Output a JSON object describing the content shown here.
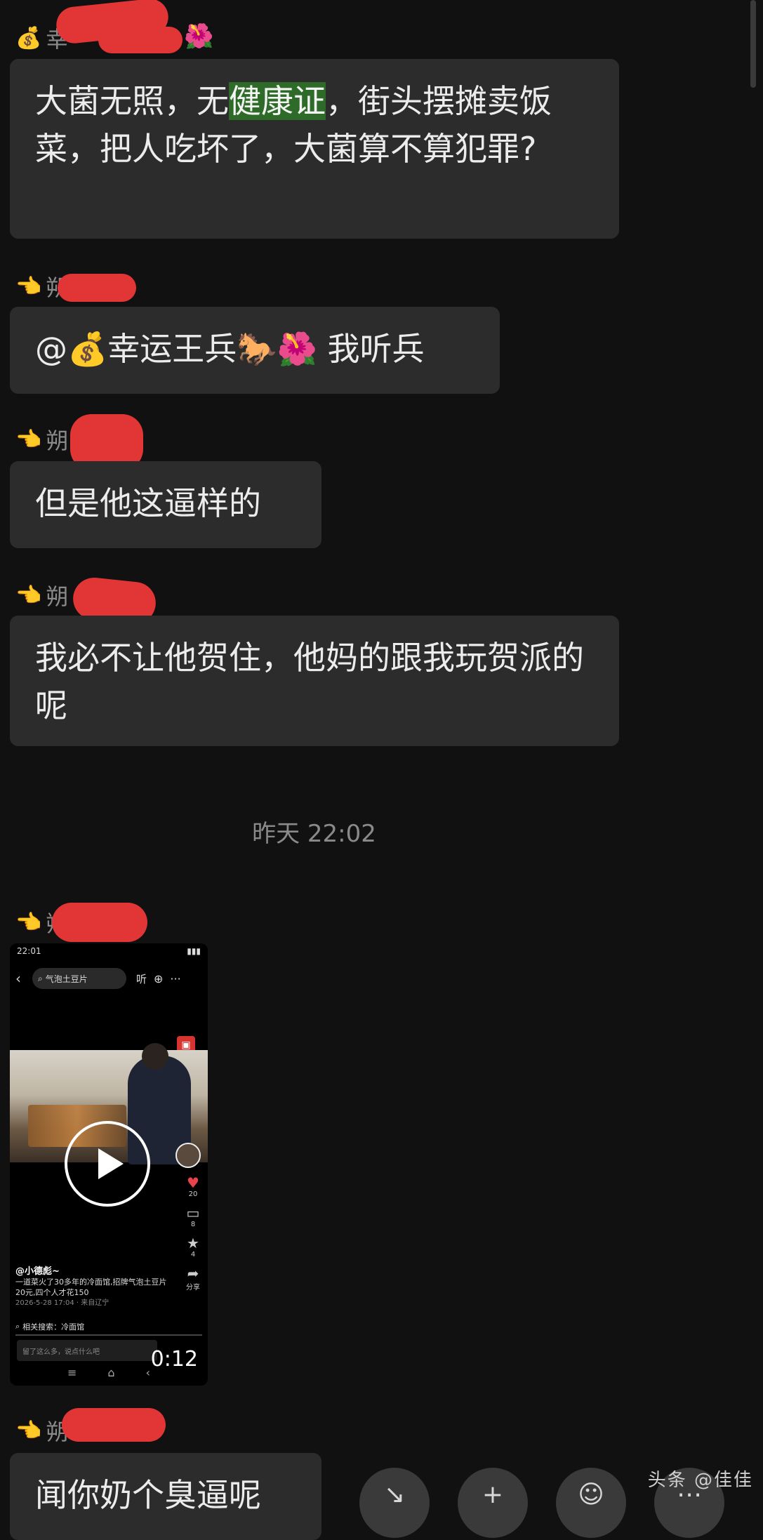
{
  "messages": [
    {
      "sender_prefix": "幸",
      "sender_icon": "money-bag-icon",
      "text_before": "大菌无照，无",
      "highlight": "健康证",
      "text_after": "，街头摆摊卖饭菜，把人吃坏了，大菌算不算犯罪?"
    },
    {
      "sender_prefix": "朔",
      "sender_icon": "pointing-hand-icon",
      "text": "@💰幸运王兵🐎🌺  我听兵"
    },
    {
      "sender_prefix": "朔",
      "sender_icon": "pointing-hand-icon",
      "text": "但是他这逼样的"
    },
    {
      "sender_prefix": "朔",
      "sender_icon": "pointing-hand-icon",
      "text": "我必不让他贺住，他妈的跟我玩贺派的呢"
    }
  ],
  "timestamp": "昨天 22:02",
  "video_message": {
    "sender_prefix": "朔",
    "status_time": "22:01",
    "search_text": "气泡土豆片",
    "listen_label": "听",
    "likes": "20",
    "comments": "8",
    "stars": "4",
    "share_label": "分享",
    "author": "@小德彪~",
    "caption": "一道菜火了30多年的冷面馆,招牌气泡土豆片20元,四个人才花150",
    "date": "2026-5-28 17:04 · 来自辽宁",
    "related_label": "相关搜索：冷面馆",
    "comment_placeholder": "留了这么多，说点什么吧",
    "duration": "0:12"
  },
  "last_message": {
    "sender_prefix": "朔",
    "text": "闻你奶个臭逼呢"
  },
  "watermark": "头条 @佳佳"
}
